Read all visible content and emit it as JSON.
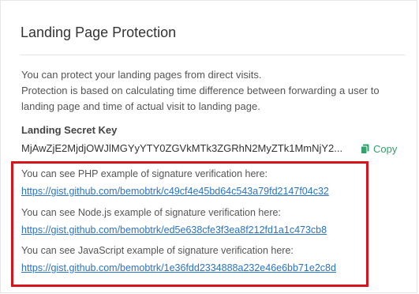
{
  "panel": {
    "title": "Landing Page Protection",
    "description": [
      "You can protect your landing pages from direct visits.",
      "Protection is based on calculating time difference between forwarding a user to",
      "landing page and time of actual visit to landing page."
    ],
    "secret_key": {
      "label": "Landing Secret Key",
      "value": "MjAwZjE2MjdjOWJlMGYyYTY0ZGVkMTk3ZGRhN2MyZTk1MmNjY2...",
      "copy_label": "Copy",
      "copy_icon": "copy-icon"
    },
    "examples": [
      {
        "text": "You can see PHP example of signature verification here:",
        "link": "https://gist.github.com/bemobtrk/c49cf4e45bd64c543a79fd2147f04c32"
      },
      {
        "text": "You can see Node.js example of signature verification here:",
        "link": "https://gist.github.com/bemobtrk/ed5e638cfe3f3ea8f212fd1a1c473cb8"
      },
      {
        "text": "You can see JavaScript example of signature verification here:",
        "link": "https://gist.github.com/bemobtrk/1e36fdd2334888a232e46e6bb71e2c8d"
      }
    ]
  },
  "colors": {
    "link": "#2a73c4",
    "copy_accent": "#2fa36b",
    "highlight_border": "#d7141e"
  }
}
